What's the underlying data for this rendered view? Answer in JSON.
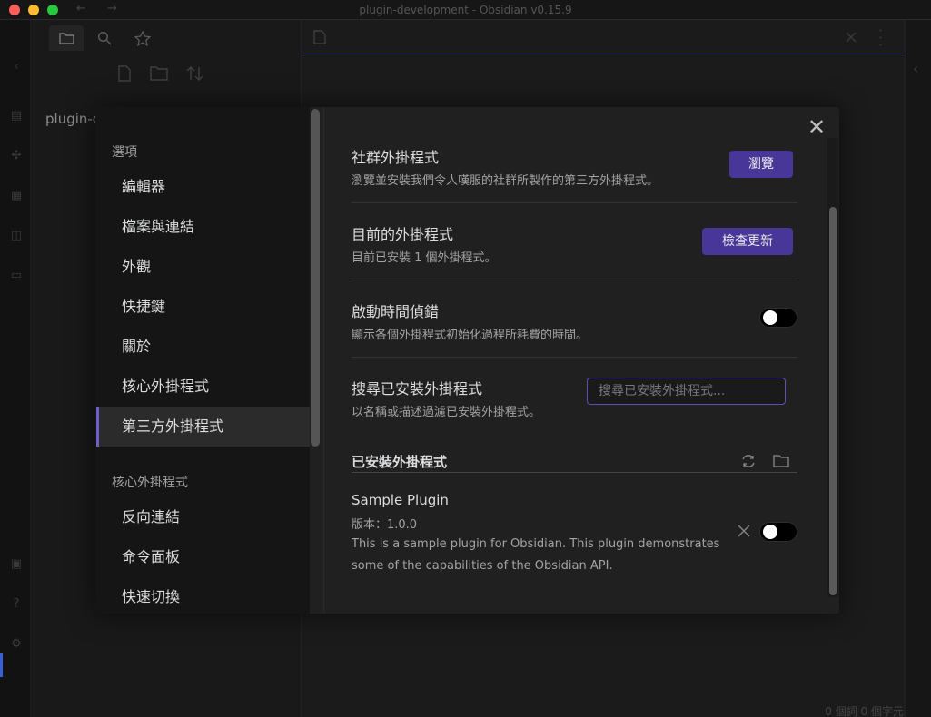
{
  "window": {
    "title": "plugin-development - Obsidian v0.15.9"
  },
  "file_pane": {
    "vault_name": "plugin-c"
  },
  "status_bar": {
    "text": "0 個詞   0 個字元"
  },
  "settings_sidebar": {
    "options_heading": "選項",
    "options_items": [
      {
        "label": "編輯器"
      },
      {
        "label": "檔案與連結"
      },
      {
        "label": "外觀"
      },
      {
        "label": "快捷鍵"
      },
      {
        "label": "關於"
      },
      {
        "label": "核心外掛程式"
      },
      {
        "label": "第三方外掛程式",
        "active": true
      }
    ],
    "core_heading": "核心外掛程式",
    "core_items": [
      {
        "label": "反向連結"
      },
      {
        "label": "命令面板"
      },
      {
        "label": "快速切換"
      }
    ]
  },
  "settings_content": {
    "community": {
      "title": "社群外掛程式",
      "desc": "瀏覽並安裝我們令人嘆服的社群所製作的第三方外掛程式。",
      "button": "瀏覽"
    },
    "current": {
      "title": "目前的外掛程式",
      "desc": "目前已安裝 1 個外掛程式。",
      "button": "檢查更新"
    },
    "debug": {
      "title": "啟動時間偵錯",
      "desc": "顯示各個外掛程式初始化過程所耗費的時間。",
      "enabled": false
    },
    "search": {
      "title": "搜尋已安裝外掛程式",
      "desc": "以名稱或描述過濾已安裝外掛程式。",
      "placeholder": "搜尋已安裝外掛程式..."
    },
    "installed_heading": "已安裝外掛程式",
    "plugins": [
      {
        "name": "Sample Plugin",
        "version": "版本：1.0.0",
        "desc": "This is a sample plugin for Obsidian. This plugin demonstrates some of the capabilities of the Obsidian API.",
        "enabled": false
      }
    ]
  },
  "colors": {
    "accent": "#483699",
    "input_focus": "#5c4fb8",
    "sidebar_active_border": "#6c5fc7"
  }
}
